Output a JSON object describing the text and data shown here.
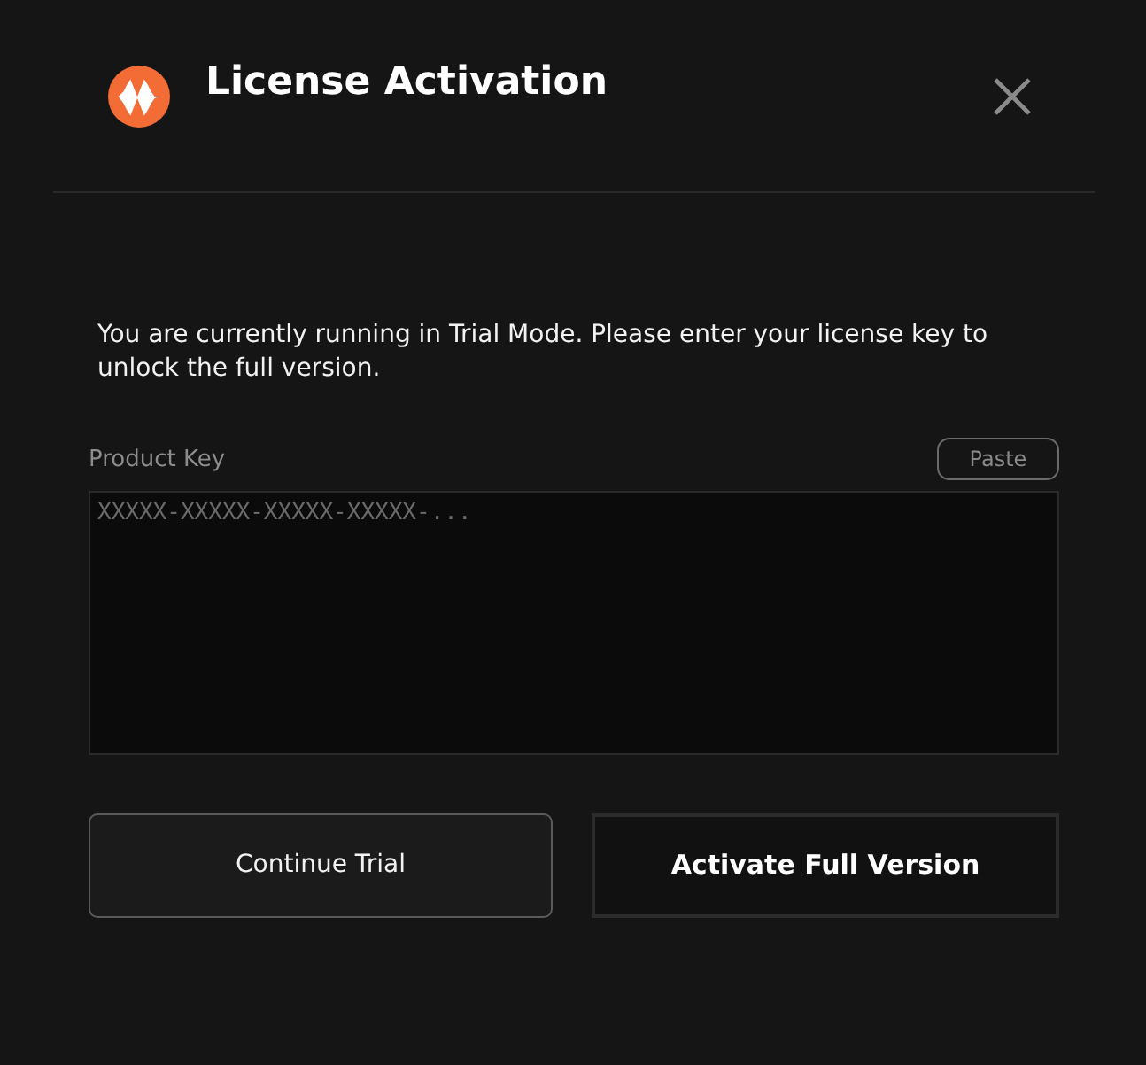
{
  "dialog": {
    "title": "License Activation",
    "message": "You are currently running in Trial Mode. Please enter your license key to unlock the full version."
  },
  "product_key": {
    "label": "Product Key",
    "paste_button": "Paste",
    "placeholder": "XXXXX-XXXXX-XXXXX-XXXXX-..."
  },
  "buttons": [
    {
      "label": "Continue Trial",
      "kind": "secondary"
    },
    {
      "label": "Activate Full Version",
      "kind": "primary"
    }
  ]
}
